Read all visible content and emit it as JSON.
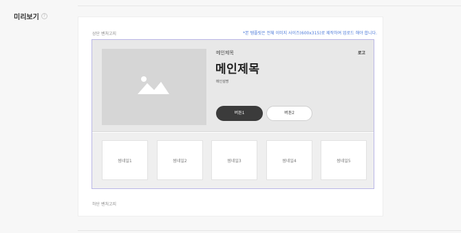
{
  "section": {
    "title": "미리보기",
    "help_icon": "question-circle-icon"
  },
  "card": {
    "top_banner_label": "상단 벤처고지",
    "notice": "*본 템플릿은 전체 이미지 사이즈(600x315)로 제작하여 업로드 해야 합니다.",
    "bottom_banner_label": "하단 벤처고지"
  },
  "hero": {
    "image_icon": "image-placeholder-icon",
    "subtitle": "메인제목",
    "title": "메인제목",
    "description": "메인설명",
    "logo": "로고",
    "button1": "버튼1",
    "button2": "버튼2"
  },
  "thumbnails": [
    "썸네일1",
    "썸네일2",
    "썸네일3",
    "썸네일4",
    "썸네일5"
  ],
  "colors": {
    "accent_border": "#b9b6e6",
    "notice_text": "#4a78d8",
    "primary_button": "#3b3b3b"
  }
}
